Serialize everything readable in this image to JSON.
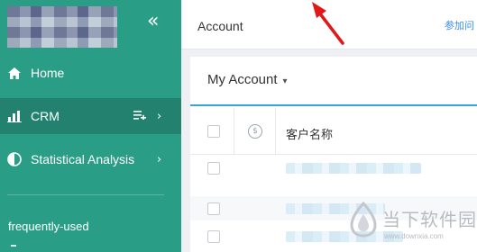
{
  "sidebar": {
    "collapse_glyph": "«",
    "items": [
      {
        "label": "Home",
        "icon": "home-icon"
      },
      {
        "label": "CRM",
        "icon": "bar-chart-icon",
        "active": true
      },
      {
        "label": "Statistical Analysis",
        "icon": "pie-chart-icon"
      }
    ],
    "section_label": "frequently-used"
  },
  "topbar": {
    "title": "Account",
    "link": "参加问"
  },
  "panel": {
    "title": "My Account",
    "table": {
      "columns": [
        "",
        "",
        "客户名称"
      ],
      "rows": 4
    }
  },
  "watermark": {
    "text": "当下软件园",
    "url": "www.downxia.com"
  },
  "colors": {
    "sidebar_bg": "#2a9d86",
    "sidebar_active": "#23826f",
    "accent_blue": "#35a5e0",
    "link_blue": "#3b8fe0",
    "annotation_red": "#e01818"
  }
}
